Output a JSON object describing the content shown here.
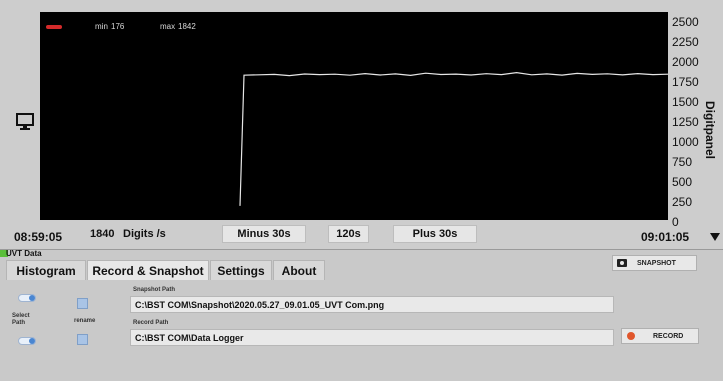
{
  "legend": {
    "min_label": "min",
    "min_value": "176",
    "max_label": "max",
    "max_value": "1842"
  },
  "y_axis": {
    "label": "Digitpanel",
    "ticks": [
      "2500",
      "2250",
      "2000",
      "1750",
      "1500",
      "1250",
      "1000",
      "750",
      "500",
      "250",
      "0"
    ]
  },
  "chart_data": {
    "type": "line",
    "ylim": [
      0,
      2500
    ],
    "ylabel": "Digitpanel",
    "x": [
      "08:59:05",
      "09:01:05"
    ],
    "series": [
      {
        "color": "#e6e6e6",
        "values": [
          176,
          1810,
          1815,
          1820,
          1805,
          1825,
          1818,
          1822,
          1810,
          1830,
          1812,
          1826,
          1808,
          1835,
          1819,
          1824,
          1813,
          1829,
          1817,
          1842,
          1815,
          1826,
          1811,
          1832,
          1820,
          1827,
          1814,
          1830,
          1818,
          1823
        ]
      }
    ]
  },
  "controls": {
    "start_time": "08:59:05",
    "rate_value": "1840",
    "rate_unit": "Digits /s",
    "minus_label": "Minus 30s",
    "window_label": "120s",
    "plus_label": "Plus 30s",
    "end_time": "09:01:05"
  },
  "section": {
    "title": "UVT Data",
    "indicator_color": "#5bbf3a"
  },
  "tabs": [
    {
      "label": "Histogram"
    },
    {
      "label": "Record & Snapshot"
    },
    {
      "label": "Settings"
    },
    {
      "label": "About"
    }
  ],
  "snapshot": {
    "button_label": "SNAPSHOT",
    "path_label": "Snapshot Path",
    "path_value": "C:\\BST COM\\Snapshot\\2020.05.27_09.01.05_UVT Com.png"
  },
  "record": {
    "button_label": "RECORD",
    "path_label": "Record Path",
    "path_value": "C:\\BST COM\\Data Logger"
  },
  "left_controls": {
    "select_path_label": "Select Path",
    "rename_label": "rename"
  },
  "icons": {
    "monitor": "monitor-icon",
    "scroll_down": "scroll-down-icon",
    "camera": "camera-icon",
    "record": "record-dot-icon"
  }
}
